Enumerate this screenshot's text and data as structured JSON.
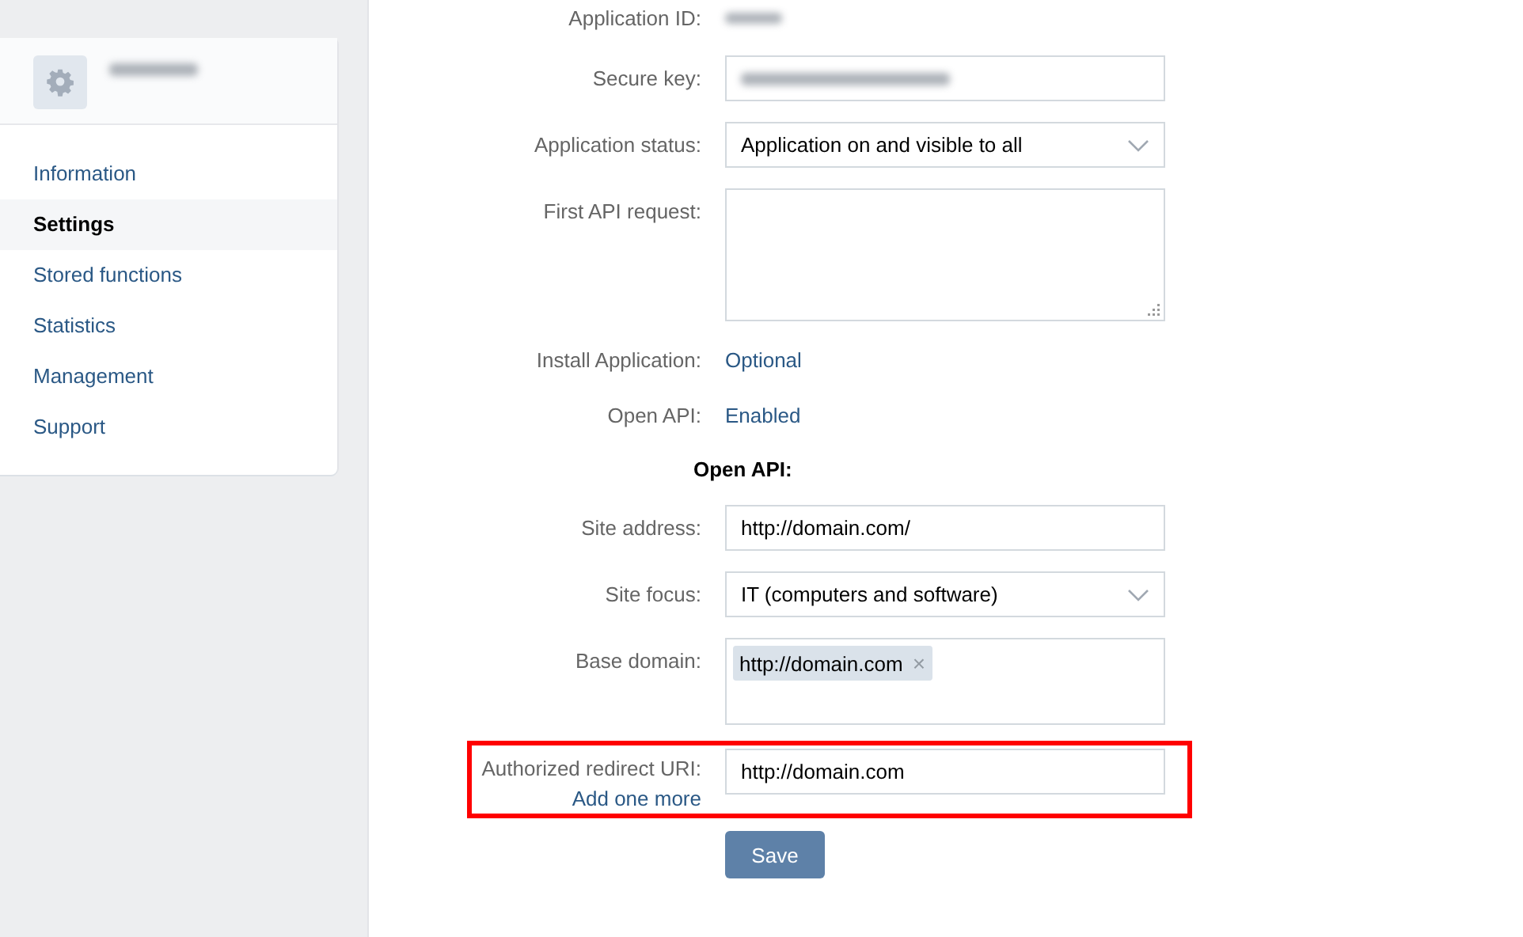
{
  "sidebar": {
    "menu": [
      {
        "label": "Information",
        "selected": false
      },
      {
        "label": "Settings",
        "selected": true
      },
      {
        "label": "Stored functions",
        "selected": false
      },
      {
        "label": "Statistics",
        "selected": false
      },
      {
        "label": "Management",
        "selected": false
      },
      {
        "label": "Support",
        "selected": false
      }
    ]
  },
  "form": {
    "rows": [
      {
        "kind": "redacted",
        "label": "Application ID:"
      },
      {
        "kind": "redacted_input",
        "label": "Secure key:"
      },
      {
        "kind": "select",
        "label": "Application status:",
        "value": "Application on and visible to all"
      },
      {
        "kind": "textarea",
        "label": "First API request:"
      },
      {
        "kind": "link_value",
        "label": "Install Application:",
        "value": "Optional"
      },
      {
        "kind": "link_value",
        "label": "Open API:",
        "value": "Enabled"
      },
      {
        "kind": "heading",
        "label": "Open API:"
      },
      {
        "kind": "input",
        "label": "Site address:",
        "value": "http://domain.com/"
      },
      {
        "kind": "select",
        "label": "Site focus:",
        "value": "IT (computers and software)"
      },
      {
        "kind": "tags",
        "label": "Base domain:",
        "tags": [
          {
            "label": "http://domain.com",
            "remove": "×"
          }
        ]
      },
      {
        "kind": "input",
        "label": "Authorized redirect URI:",
        "value": "http://domain.com",
        "link": "Add one more",
        "highlighted": true
      }
    ],
    "save_button": "Save"
  }
}
